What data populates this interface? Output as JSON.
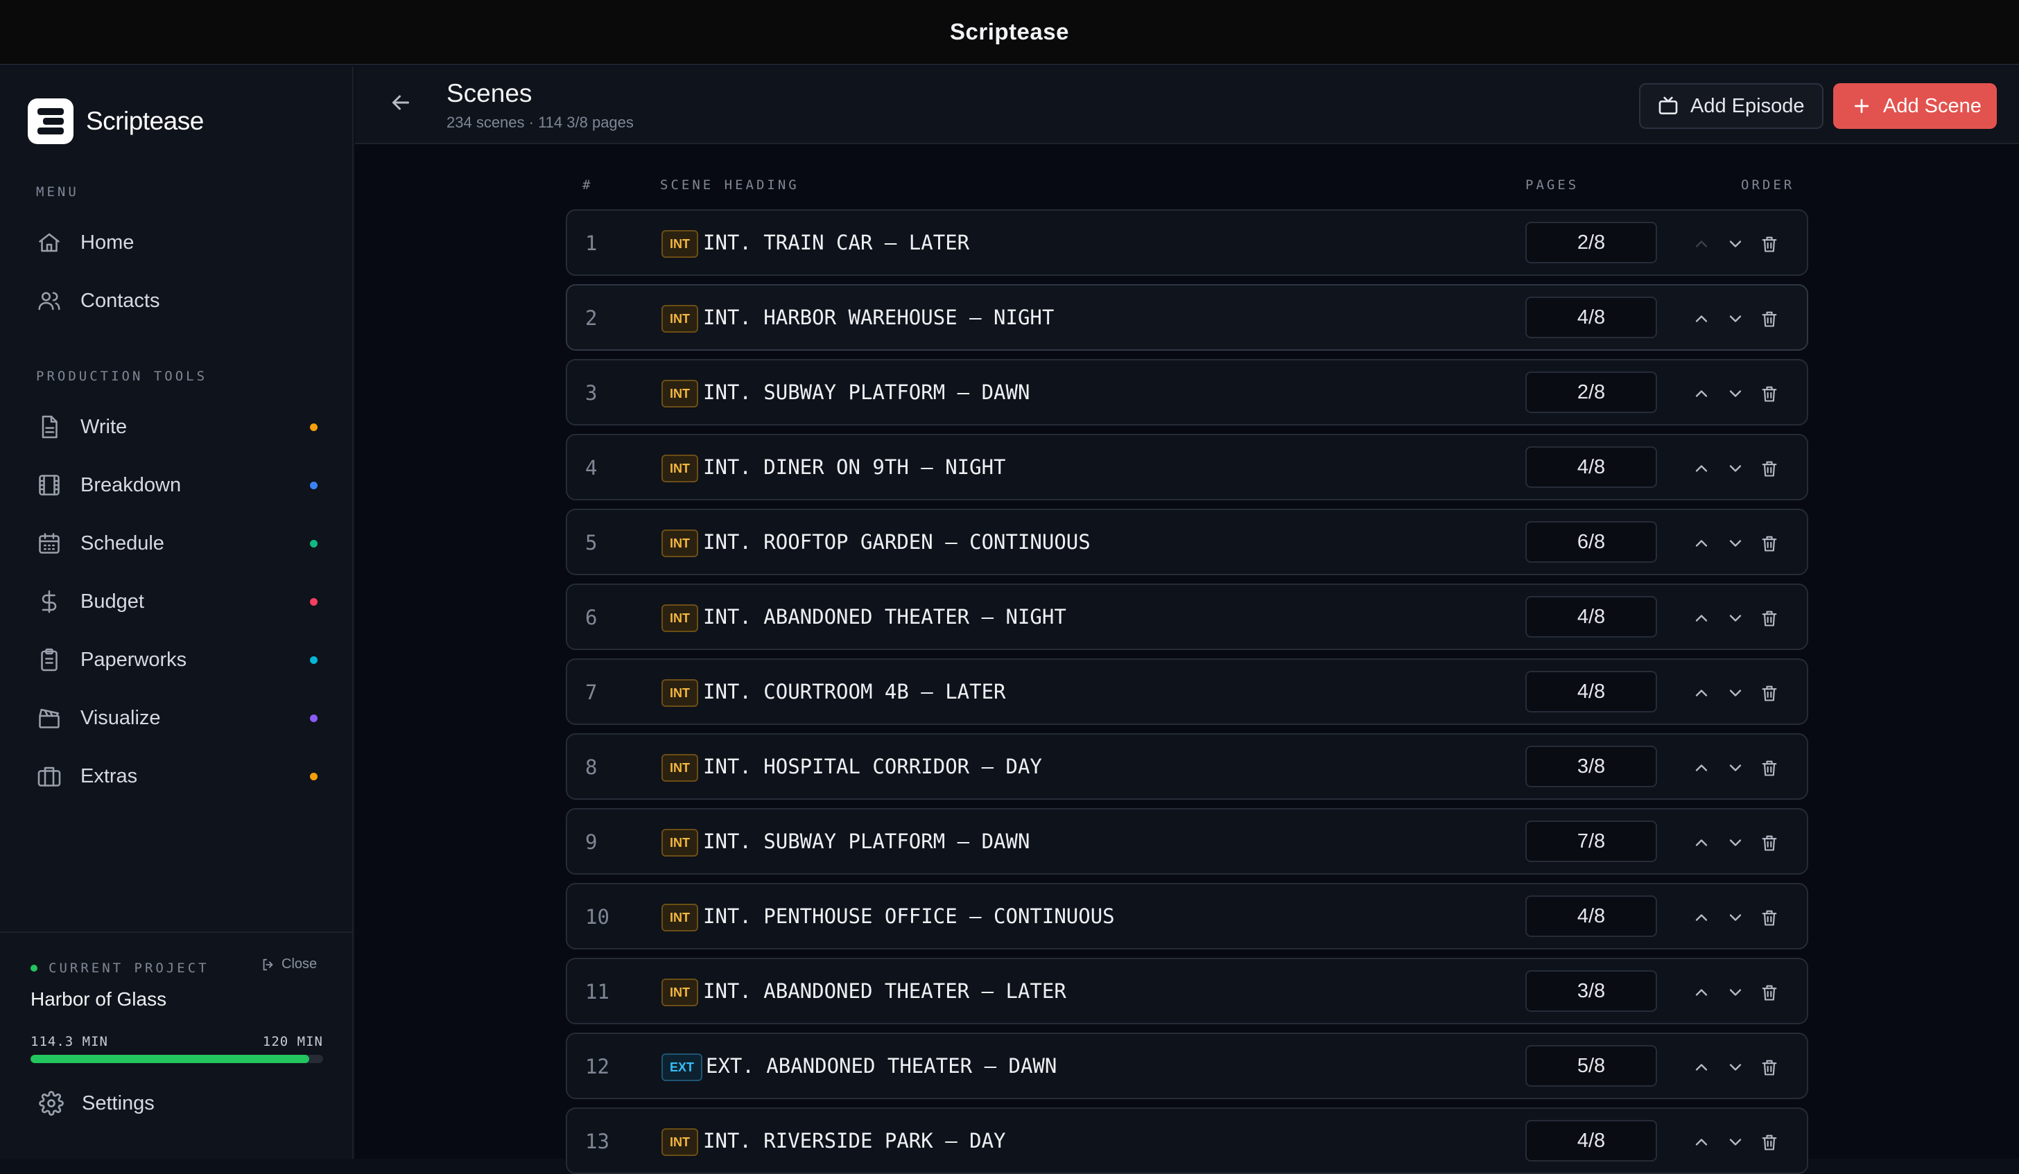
{
  "window": {
    "title": "Scriptease"
  },
  "sidebar": {
    "brand": "Scriptease",
    "menu_label": "MENU",
    "menu": [
      {
        "label": "Home",
        "icon": "home-icon"
      },
      {
        "label": "Contacts",
        "icon": "contacts-icon"
      }
    ],
    "tools_label": "PRODUCTION TOOLS",
    "tools": [
      {
        "label": "Write",
        "icon": "document-icon",
        "dot": "#f59e0b"
      },
      {
        "label": "Breakdown",
        "icon": "film-icon",
        "dot": "#3b82f6"
      },
      {
        "label": "Schedule",
        "icon": "calendar-icon",
        "dot": "#10b981"
      },
      {
        "label": "Budget",
        "icon": "dollar-icon",
        "dot": "#f43f5e"
      },
      {
        "label": "Paperworks",
        "icon": "clipboard-icon",
        "dot": "#06b6d4"
      },
      {
        "label": "Visualize",
        "icon": "clapperboard-icon",
        "dot": "#8b5cf6"
      },
      {
        "label": "Extras",
        "icon": "briefcase-icon",
        "dot": "#f59e0b"
      }
    ],
    "project": {
      "label": "CURRENT PROJECT",
      "close_label": "Close",
      "name": "Harbor of Glass",
      "runtime": "114.3 MIN",
      "target": "120 MIN",
      "progress": 0.9525
    },
    "settings_label": "Settings"
  },
  "header": {
    "title": "Scenes",
    "subtitle": "234 scenes · 114 3/8 pages",
    "add_episode": "Add Episode",
    "add_scene": "Add Scene"
  },
  "table": {
    "columns": {
      "num": "#",
      "heading": "SCENE HEADING",
      "pages": "PAGES",
      "order": "ORDER"
    },
    "rows": [
      {
        "num": "1",
        "type": "INT",
        "heading": "INT. TRAIN CAR – LATER",
        "pages": "2/8"
      },
      {
        "num": "2",
        "type": "INT",
        "heading": "INT. HARBOR WAREHOUSE – NIGHT",
        "pages": "4/8"
      },
      {
        "num": "3",
        "type": "INT",
        "heading": "INT. SUBWAY PLATFORM – DAWN",
        "pages": "2/8"
      },
      {
        "num": "4",
        "type": "INT",
        "heading": "INT. DINER ON 9TH – NIGHT",
        "pages": "4/8"
      },
      {
        "num": "5",
        "type": "INT",
        "heading": "INT. ROOFTOP GARDEN – CONTINUOUS",
        "pages": "6/8"
      },
      {
        "num": "6",
        "type": "INT",
        "heading": "INT. ABANDONED THEATER – NIGHT",
        "pages": "4/8"
      },
      {
        "num": "7",
        "type": "INT",
        "heading": "INT. COURTROOM 4B – LATER",
        "pages": "4/8"
      },
      {
        "num": "8",
        "type": "INT",
        "heading": "INT. HOSPITAL CORRIDOR – DAY",
        "pages": "3/8"
      },
      {
        "num": "9",
        "type": "INT",
        "heading": "INT. SUBWAY PLATFORM – DAWN",
        "pages": "7/8"
      },
      {
        "num": "10",
        "type": "INT",
        "heading": "INT. PENTHOUSE OFFICE – CONTINUOUS",
        "pages": "4/8"
      },
      {
        "num": "11",
        "type": "INT",
        "heading": "INT. ABANDONED THEATER – LATER",
        "pages": "3/8"
      },
      {
        "num": "12",
        "type": "EXT",
        "heading": "EXT. ABANDONED THEATER – DAWN",
        "pages": "5/8"
      },
      {
        "num": "13",
        "type": "INT",
        "heading": "INT. RIVERSIDE PARK – DAY",
        "pages": "4/8"
      }
    ]
  }
}
